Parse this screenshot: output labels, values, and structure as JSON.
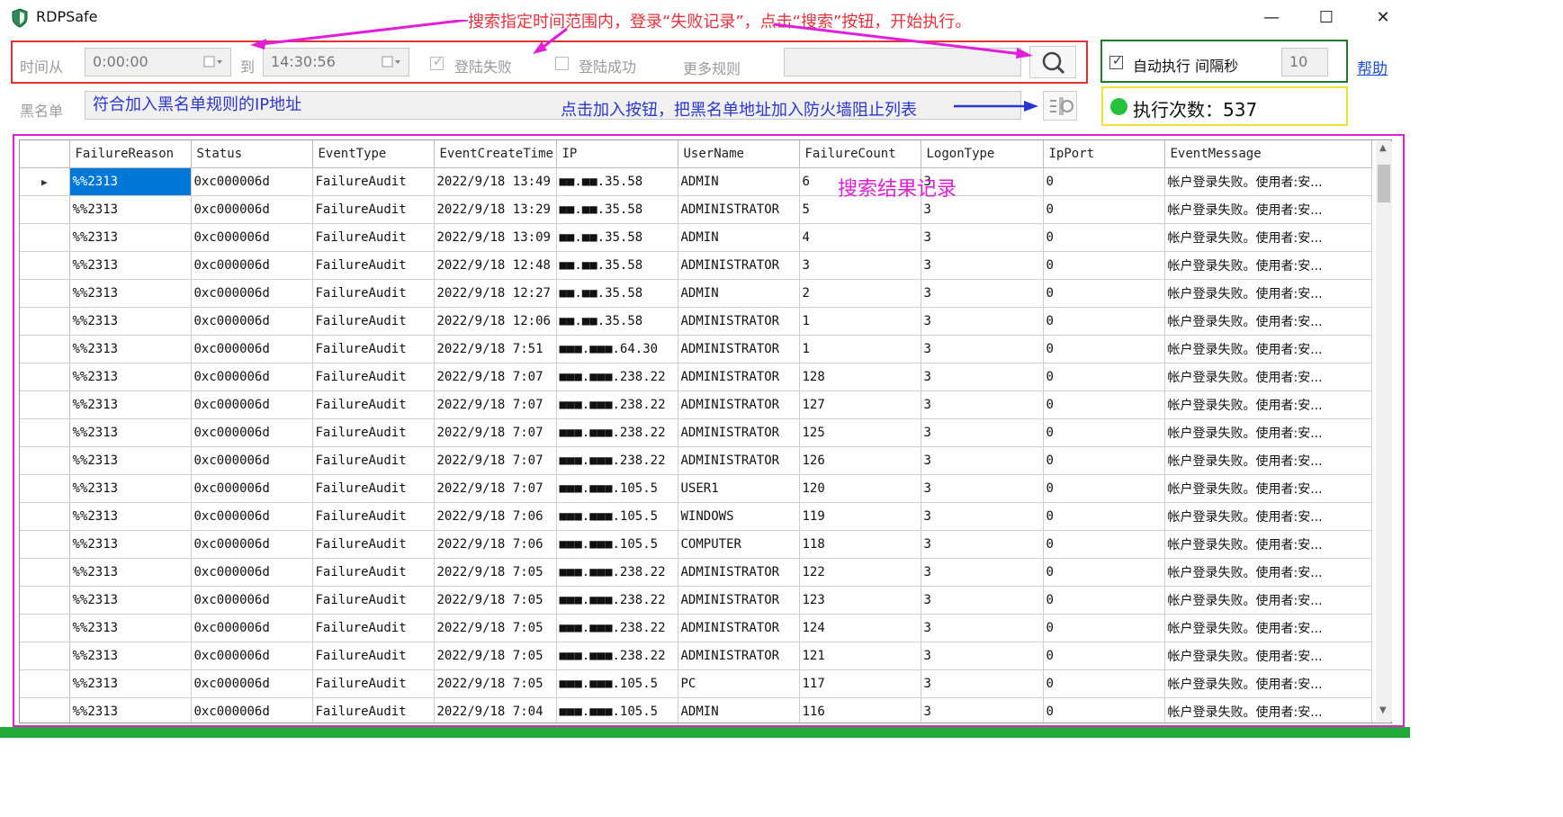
{
  "window": {
    "title": "RDPSafe",
    "minimize": "—",
    "maximize": "☐",
    "close": "✕"
  },
  "toolbar": {
    "time_from_label": "时间从",
    "time_from_value": "0:00:00",
    "to_label": "到",
    "time_to_value": "14:30:56",
    "login_fail_label": "登陆失败",
    "login_success_label": "登陆成功",
    "more_rules_label": "更多规则",
    "auto_exec_label": "自动执行 间隔秒",
    "interval_value": "10",
    "help_link": "帮助",
    "blacklist_label": "黑名单",
    "blacklist_value": "符合加入黑名单规则的IP地址",
    "exec_count_label": "执行次数：537"
  },
  "annotations": {
    "search_note": "搜索指定时间范围内，登录“失败记录”，点击“搜索”按钮，开始执行。",
    "add_note": "点击加入按钮，把黑名单地址加入防火墙阻止列表",
    "results_note": "搜索结果记录"
  },
  "colors": {
    "status_dot": "#22c33a",
    "annotation_red": "#e8303a",
    "annotation_blue": "#2a36d0",
    "annotation_magenta": "#e21fd8",
    "selection": "#0078d7"
  },
  "grid": {
    "columns": [
      "FailureReason",
      "Status",
      "EventType",
      "EventCreateTime",
      "IP",
      "UserName",
      "FailureCount",
      "LogonType",
      "IpPort",
      "EventMessage"
    ],
    "rows": [
      [
        "%%2313",
        "0xc000006d",
        "FailureAudit",
        "2022/9/18 13:49",
        "■■.■■.35.58",
        "ADMIN",
        "6",
        "3",
        "0",
        "帐户登录失败。使用者:安..."
      ],
      [
        "%%2313",
        "0xc000006d",
        "FailureAudit",
        "2022/9/18 13:29",
        "■■.■■.35.58",
        "ADMINISTRATOR",
        "5",
        "3",
        "0",
        "帐户登录失败。使用者:安..."
      ],
      [
        "%%2313",
        "0xc000006d",
        "FailureAudit",
        "2022/9/18 13:09",
        "■■.■■.35.58",
        "ADMIN",
        "4",
        "3",
        "0",
        "帐户登录失败。使用者:安..."
      ],
      [
        "%%2313",
        "0xc000006d",
        "FailureAudit",
        "2022/9/18 12:48",
        "■■.■■.35.58",
        "ADMINISTRATOR",
        "3",
        "3",
        "0",
        "帐户登录失败。使用者:安..."
      ],
      [
        "%%2313",
        "0xc000006d",
        "FailureAudit",
        "2022/9/18 12:27",
        "■■.■■.35.58",
        "ADMIN",
        "2",
        "3",
        "0",
        "帐户登录失败。使用者:安..."
      ],
      [
        "%%2313",
        "0xc000006d",
        "FailureAudit",
        "2022/9/18 12:06",
        "■■.■■.35.58",
        "ADMINISTRATOR",
        "1",
        "3",
        "0",
        "帐户登录失败。使用者:安..."
      ],
      [
        "%%2313",
        "0xc000006d",
        "FailureAudit",
        "2022/9/18 7:51",
        "■■■.■■■.64.30",
        "ADMINISTRATOR",
        "1",
        "3",
        "0",
        "帐户登录失败。使用者:安..."
      ],
      [
        "%%2313",
        "0xc000006d",
        "FailureAudit",
        "2022/9/18 7:07",
        "■■■.■■■.238.22",
        "ADMINISTRATOR",
        "128",
        "3",
        "0",
        "帐户登录失败。使用者:安..."
      ],
      [
        "%%2313",
        "0xc000006d",
        "FailureAudit",
        "2022/9/18 7:07",
        "■■■.■■■.238.22",
        "ADMINISTRATOR",
        "127",
        "3",
        "0",
        "帐户登录失败。使用者:安..."
      ],
      [
        "%%2313",
        "0xc000006d",
        "FailureAudit",
        "2022/9/18 7:07",
        "■■■.■■■.238.22",
        "ADMINISTRATOR",
        "125",
        "3",
        "0",
        "帐户登录失败。使用者:安..."
      ],
      [
        "%%2313",
        "0xc000006d",
        "FailureAudit",
        "2022/9/18 7:07",
        "■■■.■■■.238.22",
        "ADMINISTRATOR",
        "126",
        "3",
        "0",
        "帐户登录失败。使用者:安..."
      ],
      [
        "%%2313",
        "0xc000006d",
        "FailureAudit",
        "2022/9/18 7:07",
        "■■■.■■■.105.5",
        "USER1",
        "120",
        "3",
        "0",
        "帐户登录失败。使用者:安..."
      ],
      [
        "%%2313",
        "0xc000006d",
        "FailureAudit",
        "2022/9/18 7:06",
        "■■■.■■■.105.5",
        "WINDOWS",
        "119",
        "3",
        "0",
        "帐户登录失败。使用者:安..."
      ],
      [
        "%%2313",
        "0xc000006d",
        "FailureAudit",
        "2022/9/18 7:06",
        "■■■.■■■.105.5",
        "COMPUTER",
        "118",
        "3",
        "0",
        "帐户登录失败。使用者:安..."
      ],
      [
        "%%2313",
        "0xc000006d",
        "FailureAudit",
        "2022/9/18 7:05",
        "■■■.■■■.238.22",
        "ADMINISTRATOR",
        "122",
        "3",
        "0",
        "帐户登录失败。使用者:安..."
      ],
      [
        "%%2313",
        "0xc000006d",
        "FailureAudit",
        "2022/9/18 7:05",
        "■■■.■■■.238.22",
        "ADMINISTRATOR",
        "123",
        "3",
        "0",
        "帐户登录失败。使用者:安..."
      ],
      [
        "%%2313",
        "0xc000006d",
        "FailureAudit",
        "2022/9/18 7:05",
        "■■■.■■■.238.22",
        "ADMINISTRATOR",
        "124",
        "3",
        "0",
        "帐户登录失败。使用者:安..."
      ],
      [
        "%%2313",
        "0xc000006d",
        "FailureAudit",
        "2022/9/18 7:05",
        "■■■.■■■.238.22",
        "ADMINISTRATOR",
        "121",
        "3",
        "0",
        "帐户登录失败。使用者:安..."
      ],
      [
        "%%2313",
        "0xc000006d",
        "FailureAudit",
        "2022/9/18 7:05",
        "■■■.■■■.105.5",
        "PC",
        "117",
        "3",
        "0",
        "帐户登录失败。使用者:安..."
      ],
      [
        "%%2313",
        "0xc000006d",
        "FailureAudit",
        "2022/9/18 7:04",
        "■■■.■■■.105.5",
        "ADMIN",
        "116",
        "3",
        "0",
        "帐户登录失败。使用者:安..."
      ]
    ]
  }
}
